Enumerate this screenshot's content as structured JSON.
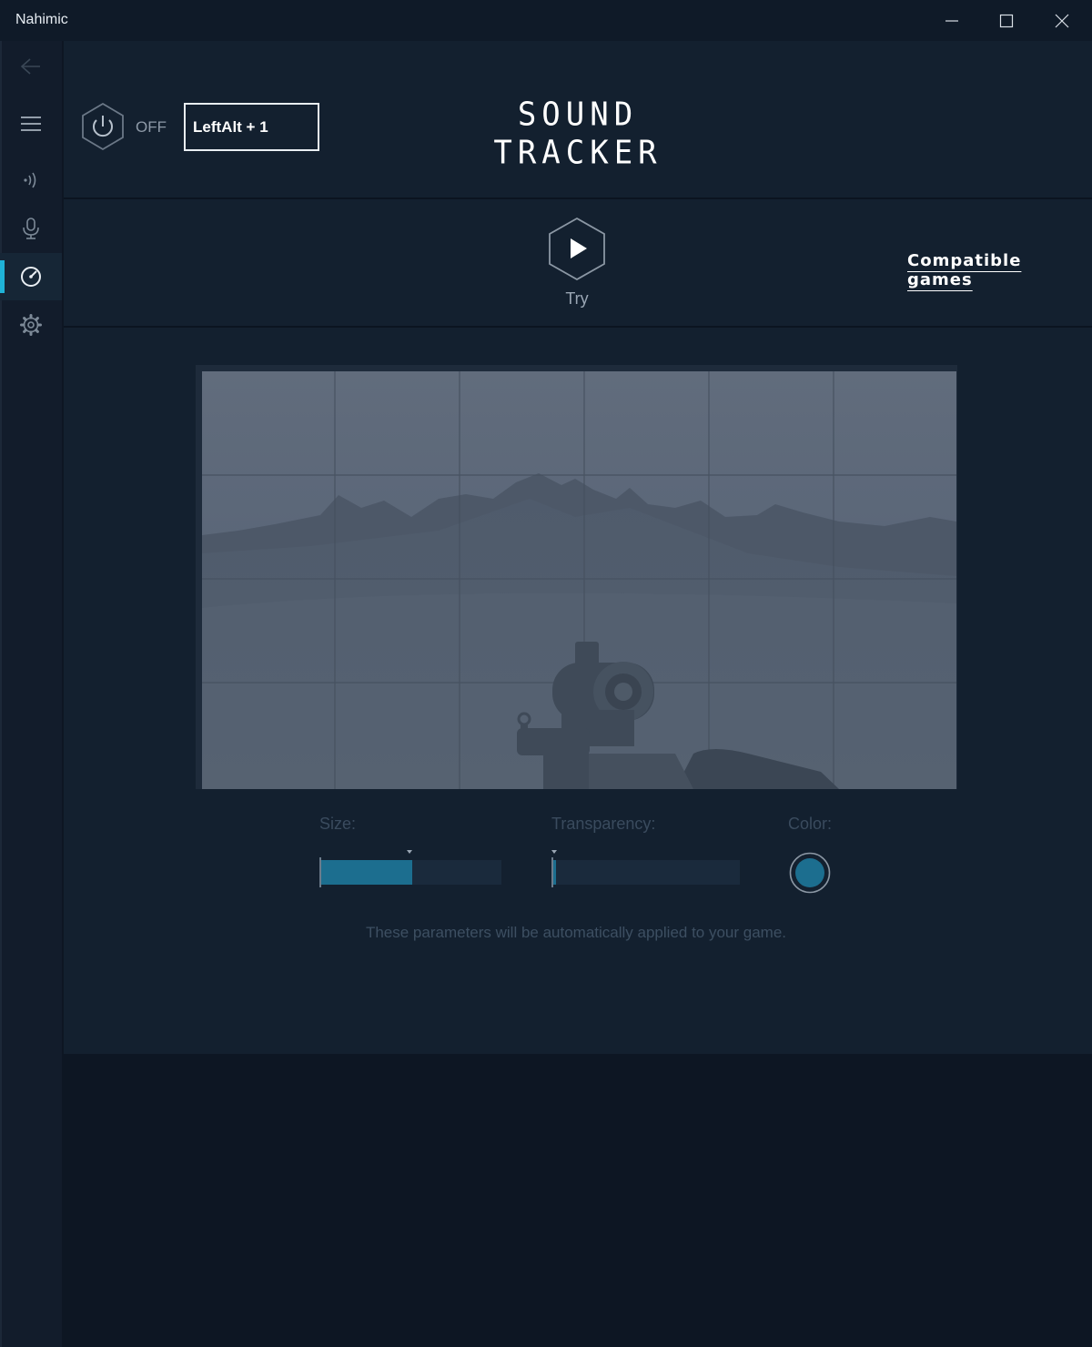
{
  "window": {
    "title": "Nahimic"
  },
  "header": {
    "power_state": "OFF",
    "hotkey": "LeftAlt + 1",
    "page_title": "SOUND TRACKER"
  },
  "try_section": {
    "try_label": "Try",
    "compatible_games_link": "Compatible games"
  },
  "sidebar": {
    "items": [
      {
        "name": "back",
        "icon": "back-arrow-icon"
      },
      {
        "name": "menu",
        "icon": "hamburger-menu-icon"
      },
      {
        "name": "audio",
        "icon": "sound-waves-icon"
      },
      {
        "name": "microphone",
        "icon": "microphone-icon"
      },
      {
        "name": "sound-tracker",
        "icon": "radar-icon",
        "selected": true
      },
      {
        "name": "settings",
        "icon": "gear-icon"
      }
    ]
  },
  "params": {
    "size_label": "Size:",
    "size_value": 0.51,
    "transparency_label": "Transparency:",
    "transparency_value": 0.02,
    "color_label": "Color:",
    "color_value": "#1c6e8f",
    "note": "These parameters will be automatically applied to your game."
  },
  "colors": {
    "accent": "#1fb3d8",
    "panel": "#13202f",
    "background": "#0d1623"
  }
}
